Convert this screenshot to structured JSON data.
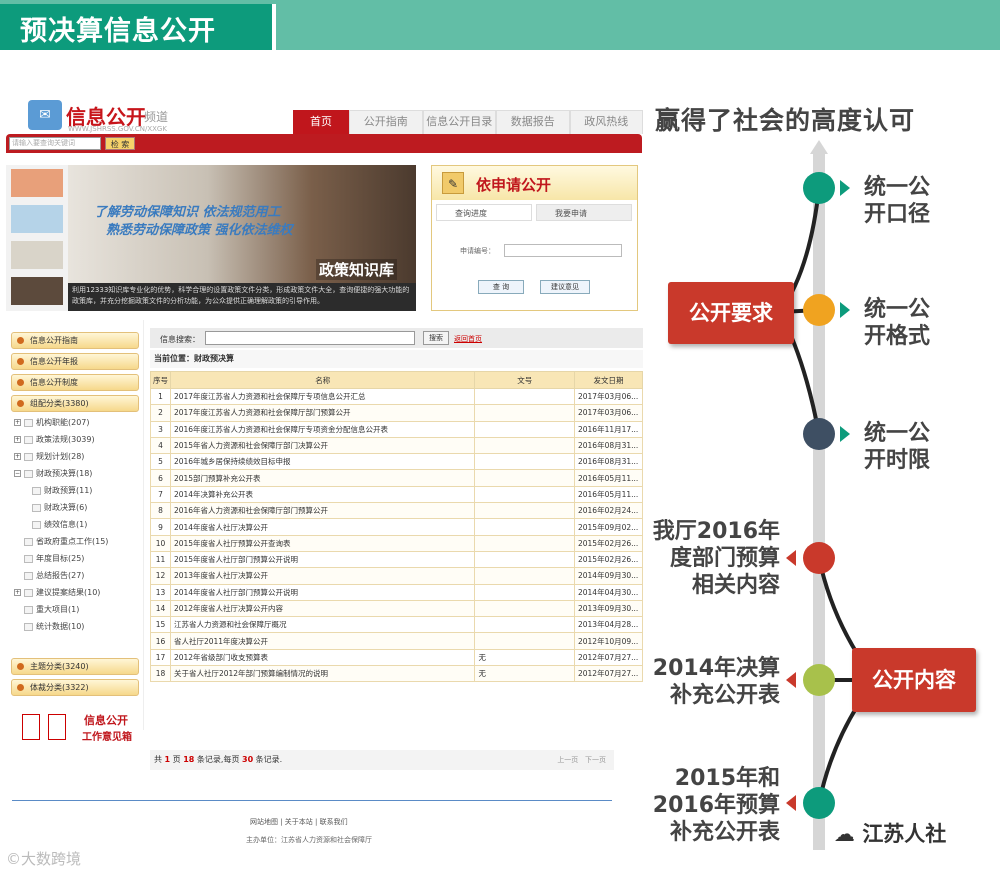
{
  "banner": {
    "title": "预决算信息公开"
  },
  "site": {
    "logo_text": "信息公开",
    "logo_sub": "频道",
    "logo_url": "WWW.JSHRSS.GOV.CN/XXGK",
    "nav": [
      "首页",
      "公开指南",
      "信息公开目录",
      "数据报告",
      "政风热线"
    ],
    "search_placeholder": "请输入要查询关键词",
    "search_button": "检 索",
    "hero_line1": "了解劳动保障知识  依法规范用工",
    "hero_line2": "熟悉劳动保障政策  强化依法维权",
    "hero_kb": "政策知识库",
    "hero_desc": "利用12333知识库专业化的优势，科学合理的设置政策文件分类，形成政策文件大全，查询便捷的强大功能的政策库，并充分挖掘政策文件的分析功能，为公众提供正确理解政策的引导作用。",
    "apply_title": "依申请公开",
    "apply_tab1": "查询进度",
    "apply_tab2": "我要申请",
    "apply_label": "申请编号：",
    "apply_btn1": "查 询",
    "apply_btn2": "建议意见",
    "menu_top": [
      "信息公开指南",
      "信息公开年报",
      "信息公开制度",
      "组配分类(3380)"
    ],
    "tree": [
      "机构职能(207)",
      "政策法规(3039)",
      "规划计划(28)",
      "财政预决算(18)",
      "财政预算(11)",
      "财政决算(6)",
      "绩效信息(1)",
      "省政府重点工作(15)",
      "年度目标(25)",
      "总结报告(27)",
      "建议提案结果(10)",
      "重大项目(1)",
      "统计数据(10)"
    ],
    "menu_bottom": [
      "主题分类(3240)",
      "体裁分类(3322)"
    ],
    "work_t1": "信息公开",
    "work_t2": "工作意见箱",
    "content_search_label": "信息搜索：",
    "content_search_btn": "搜索",
    "content_back": "返回首页",
    "position": "当前位置：财政预决算",
    "headers": [
      "序号",
      "名称",
      "文号",
      "发文日期"
    ],
    "rows": [
      [
        "1",
        "2017年度江苏省人力资源和社会保障厅专项信息公开汇总",
        "",
        "2017年03月06..."
      ],
      [
        "2",
        "2017年度江苏省人力资源和社会保障厅部门预算公开",
        "",
        "2017年03月06..."
      ],
      [
        "3",
        "2016年度江苏省人力资源和社会保障厅专项资金分配信息公开表",
        "",
        "2016年11月17..."
      ],
      [
        "4",
        "2015年省人力资源和社会保障厅部门决算公开",
        "",
        "2016年08月31..."
      ],
      [
        "5",
        "2016年城乡居保持续绩效目标申报",
        "",
        "2016年08月31..."
      ],
      [
        "6",
        "2015部门预算补充公开表",
        "",
        "2016年05月11..."
      ],
      [
        "7",
        "2014年决算补充公开表",
        "",
        "2016年05月11..."
      ],
      [
        "8",
        "2016年省人力资源和社会保障厅部门预算公开",
        "",
        "2016年02月24..."
      ],
      [
        "9",
        "2014年度省人社厅决算公开",
        "",
        "2015年09月02..."
      ],
      [
        "10",
        "2015年度省人社厅预算公开查询表",
        "",
        "2015年02月26..."
      ],
      [
        "11",
        "2015年度省人社厅部门预算公开说明",
        "",
        "2015年02月26..."
      ],
      [
        "12",
        "2013年度省人社厅决算公开",
        "",
        "2014年09月30..."
      ],
      [
        "13",
        "2014年度省人社厅部门预算公开说明",
        "",
        "2014年04月30..."
      ],
      [
        "14",
        "2012年度省人社厅决算公开内容",
        "",
        "2013年09月30..."
      ],
      [
        "15",
        "江苏省人力资源和社会保障厅概况",
        "",
        "2013年04月28..."
      ],
      [
        "16",
        "省人社厅2011年度决算公开",
        "",
        "2012年10月09..."
      ],
      [
        "17",
        "2012年省级部门收支预算表",
        "无",
        "2012年07月27..."
      ],
      [
        "18",
        "关于省人社厅2012年部门预算编制情况的说明",
        "无",
        "2012年07月27..."
      ]
    ],
    "pager": {
      "pre": "共 ",
      "pages": "1",
      "mid1": " 页 ",
      "records": "18",
      "mid2": " 条记录,每页 ",
      "per": "30",
      "post": " 条记录.",
      "prev": "上一页",
      "next": "下一页"
    },
    "footer1": "网站地图  |  关于本站  |  联系我们",
    "footer2": "主办单位：江苏省人力资源和社会保障厅"
  },
  "right": {
    "title": "赢得了社会的高度认可",
    "box1": "公开要求",
    "box2": "公开内容",
    "items": [
      {
        "label": "统一公\n开口径",
        "color": "#0d9b7c"
      },
      {
        "label": "统一公\n开格式",
        "color": "#f0a320"
      },
      {
        "label": "统一公\n开时限",
        "color": "#3e4f63"
      },
      {
        "label": "我厅2016年\n度部门预算\n相关内容",
        "color": "#c9392b"
      },
      {
        "label": "2014年决算\n补充公开表",
        "color": "#a8c14b"
      },
      {
        "label": "2015年和\n2016年预算\n补充公开表",
        "color": "#0d9b7c"
      }
    ],
    "wx": "江苏人社"
  },
  "watermark": "大数跨境"
}
